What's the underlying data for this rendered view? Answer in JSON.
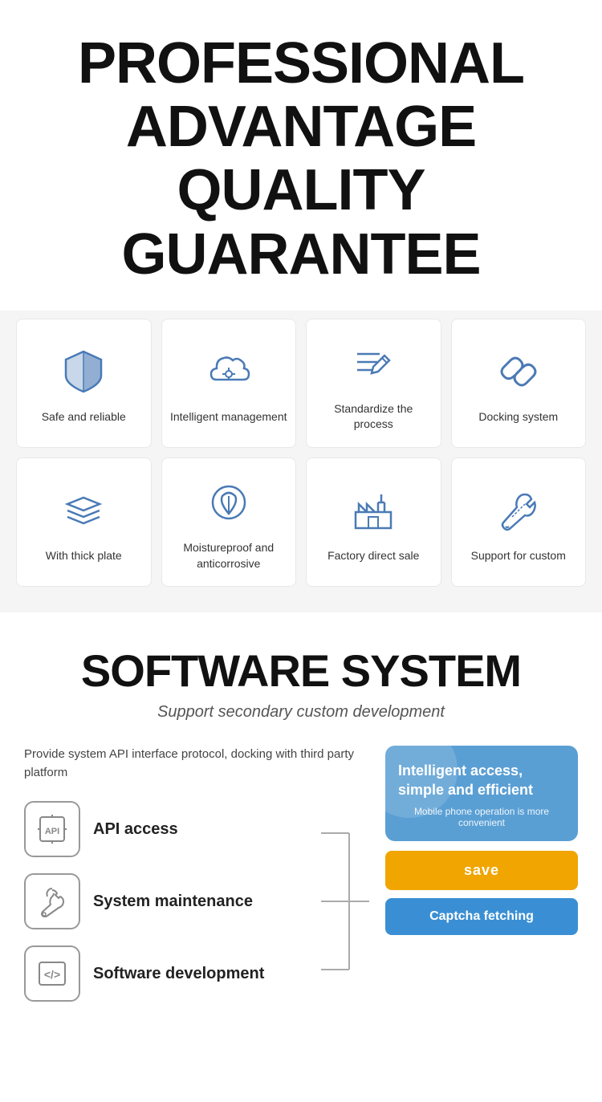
{
  "header": {
    "line1": "PROFESSIONAL",
    "line2": "ADVANTAGE",
    "line3": "QUALITY GUARANTEE"
  },
  "grid": {
    "row1": [
      {
        "id": "safe-reliable",
        "label": "Safe and reliable",
        "icon": "shield"
      },
      {
        "id": "intelligent-management",
        "label": "Intelligent management",
        "icon": "cloud-settings"
      },
      {
        "id": "standardize-process",
        "label": "Standardize the process",
        "icon": "pen-list"
      },
      {
        "id": "docking-system",
        "label": "Docking system",
        "icon": "link"
      }
    ],
    "row2": [
      {
        "id": "thick-plate",
        "label": "With thick plate",
        "icon": "layers"
      },
      {
        "id": "moistureproof",
        "label": "Moistureproof and anticorrosive",
        "icon": "leaf-shield"
      },
      {
        "id": "factory-direct",
        "label": "Factory direct sale",
        "icon": "factory"
      },
      {
        "id": "support-custom",
        "label": "Support for custom",
        "icon": "tools"
      }
    ]
  },
  "software": {
    "title": "SOFTWARE SYSTEM",
    "subtitle": "Support secondary custom development",
    "description": "Provide system API interface protocol, docking with third party platform",
    "items": [
      {
        "id": "api-access",
        "label": "API access",
        "icon": "api"
      },
      {
        "id": "system-maintenance",
        "label": "System maintenance",
        "icon": "maintenance"
      },
      {
        "id": "software-development",
        "label": "Software development",
        "icon": "code"
      }
    ],
    "panel": {
      "title": "Intelligent access, simple and efficient",
      "subtitle": "Mobile phone operation is more convenient",
      "save_btn": "save",
      "captcha_btn": "Captcha fetching"
    }
  }
}
